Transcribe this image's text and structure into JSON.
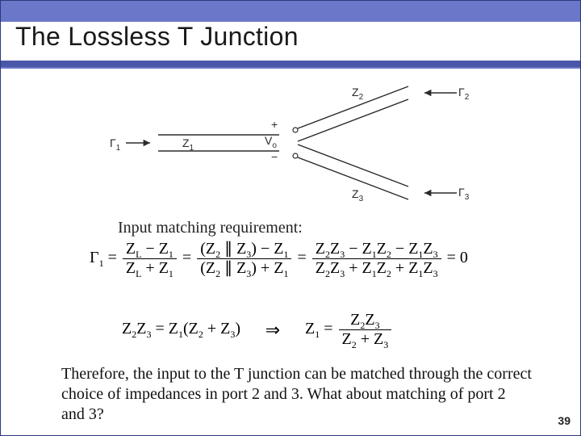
{
  "title": "The Lossless T Junction",
  "diagram": {
    "gamma1": "Γ",
    "gamma1_sub": "1",
    "z1": "Z",
    "z1_sub": "1",
    "vo_plus": "+",
    "vo": "V",
    "vo_sub": "o",
    "vo_minus": "−",
    "z2": "Z",
    "z2_sub": "2",
    "gamma2": "Γ",
    "gamma2_sub": "2",
    "z3": "Z",
    "z3_sub": "3",
    "gamma3": "Γ",
    "gamma3_sub": "3"
  },
  "subheading": "Input matching requirement:",
  "eq1": {
    "lhs_gamma": "Γ",
    "lhs_sub": "1",
    "num1a": "Z",
    "num1a_s": "L",
    "num1b": "Z",
    "num1b_s": "1",
    "den1a": "Z",
    "den1a_s": "L",
    "den1b": "Z",
    "den1b_s": "1",
    "p_z2": "Z",
    "p_z2_s": "2",
    "p_z3": "Z",
    "p_z3_s": "3",
    "z1": "Z",
    "z1_s": "1",
    "num3_t1a": "Z",
    "num3_t1a_s": "2",
    "num3_t1b": "Z",
    "num3_t1b_s": "3",
    "num3_t2a": "Z",
    "num3_t2a_s": "1",
    "num3_t2b": "Z",
    "num3_t2b_s": "2",
    "num3_t3a": "Z",
    "num3_t3a_s": "1",
    "num3_t3b": "Z",
    "num3_t3b_s": "3",
    "den3_t1a": "Z",
    "den3_t1a_s": "2",
    "den3_t1b": "Z",
    "den3_t1b_s": "3",
    "den3_t2a": "Z",
    "den3_t2a_s": "1",
    "den3_t2b": "Z",
    "den3_t2b_s": "2",
    "den3_t3a": "Z",
    "den3_t3a_s": "1",
    "den3_t3b": "Z",
    "den3_t3b_s": "3",
    "tail": "= 0"
  },
  "eq2": {
    "l_z2": "Z",
    "l_z2_s": "2",
    "l_z3": "Z",
    "l_z3_s": "3",
    "r_z1": "Z",
    "r_z1_s": "1",
    "r_z2": "Z",
    "r_z2_s": "2",
    "r_z3": "Z",
    "r_z3_s": "3",
    "arrow": "⇒",
    "res_z1": "Z",
    "res_z1_s": "1",
    "numA": "Z",
    "numA_s": "2",
    "numB": "Z",
    "numB_s": "3",
    "denA": "Z",
    "denA_s": "2",
    "denB": "Z",
    "denB_s": "3"
  },
  "body": "Therefore, the input to the T junction can be matched through the correct choice of impedances in port 2 and 3. What about matching of port 2 and 3?",
  "page": "39"
}
